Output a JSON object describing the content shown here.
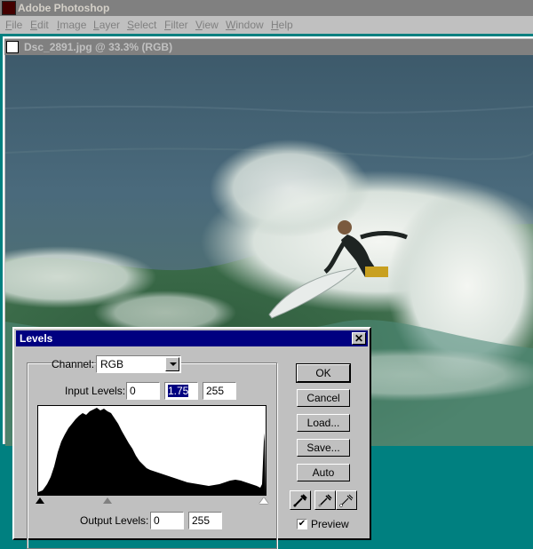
{
  "app": {
    "title": "Adobe Photoshop"
  },
  "menu": [
    "File",
    "Edit",
    "Image",
    "Layer",
    "Select",
    "Filter",
    "View",
    "Window",
    "Help"
  ],
  "document": {
    "title": "Dsc_2891.jpg @ 33.3% (RGB)"
  },
  "levels": {
    "title": "Levels",
    "close_glyph": "✕",
    "channel_label": "Channel:",
    "channel_value": "RGB",
    "input_label": "Input Levels:",
    "input_black": "0",
    "input_gamma": "1.75",
    "input_white": "255",
    "output_label": "Output Levels:",
    "output_black": "0",
    "output_white": "255",
    "buttons": {
      "ok": "OK",
      "cancel": "Cancel",
      "load": "Load...",
      "save": "Save...",
      "auto": "Auto"
    },
    "eyedroppers": [
      "black-eyedropper-icon",
      "gray-eyedropper-icon",
      "white-eyedropper-icon"
    ],
    "preview_label": "Preview",
    "preview_checked": true
  },
  "colors": {
    "desktop": "#008080",
    "active_title": "#000080",
    "inactive_title": "#808080",
    "face": "#c0c0c0"
  }
}
